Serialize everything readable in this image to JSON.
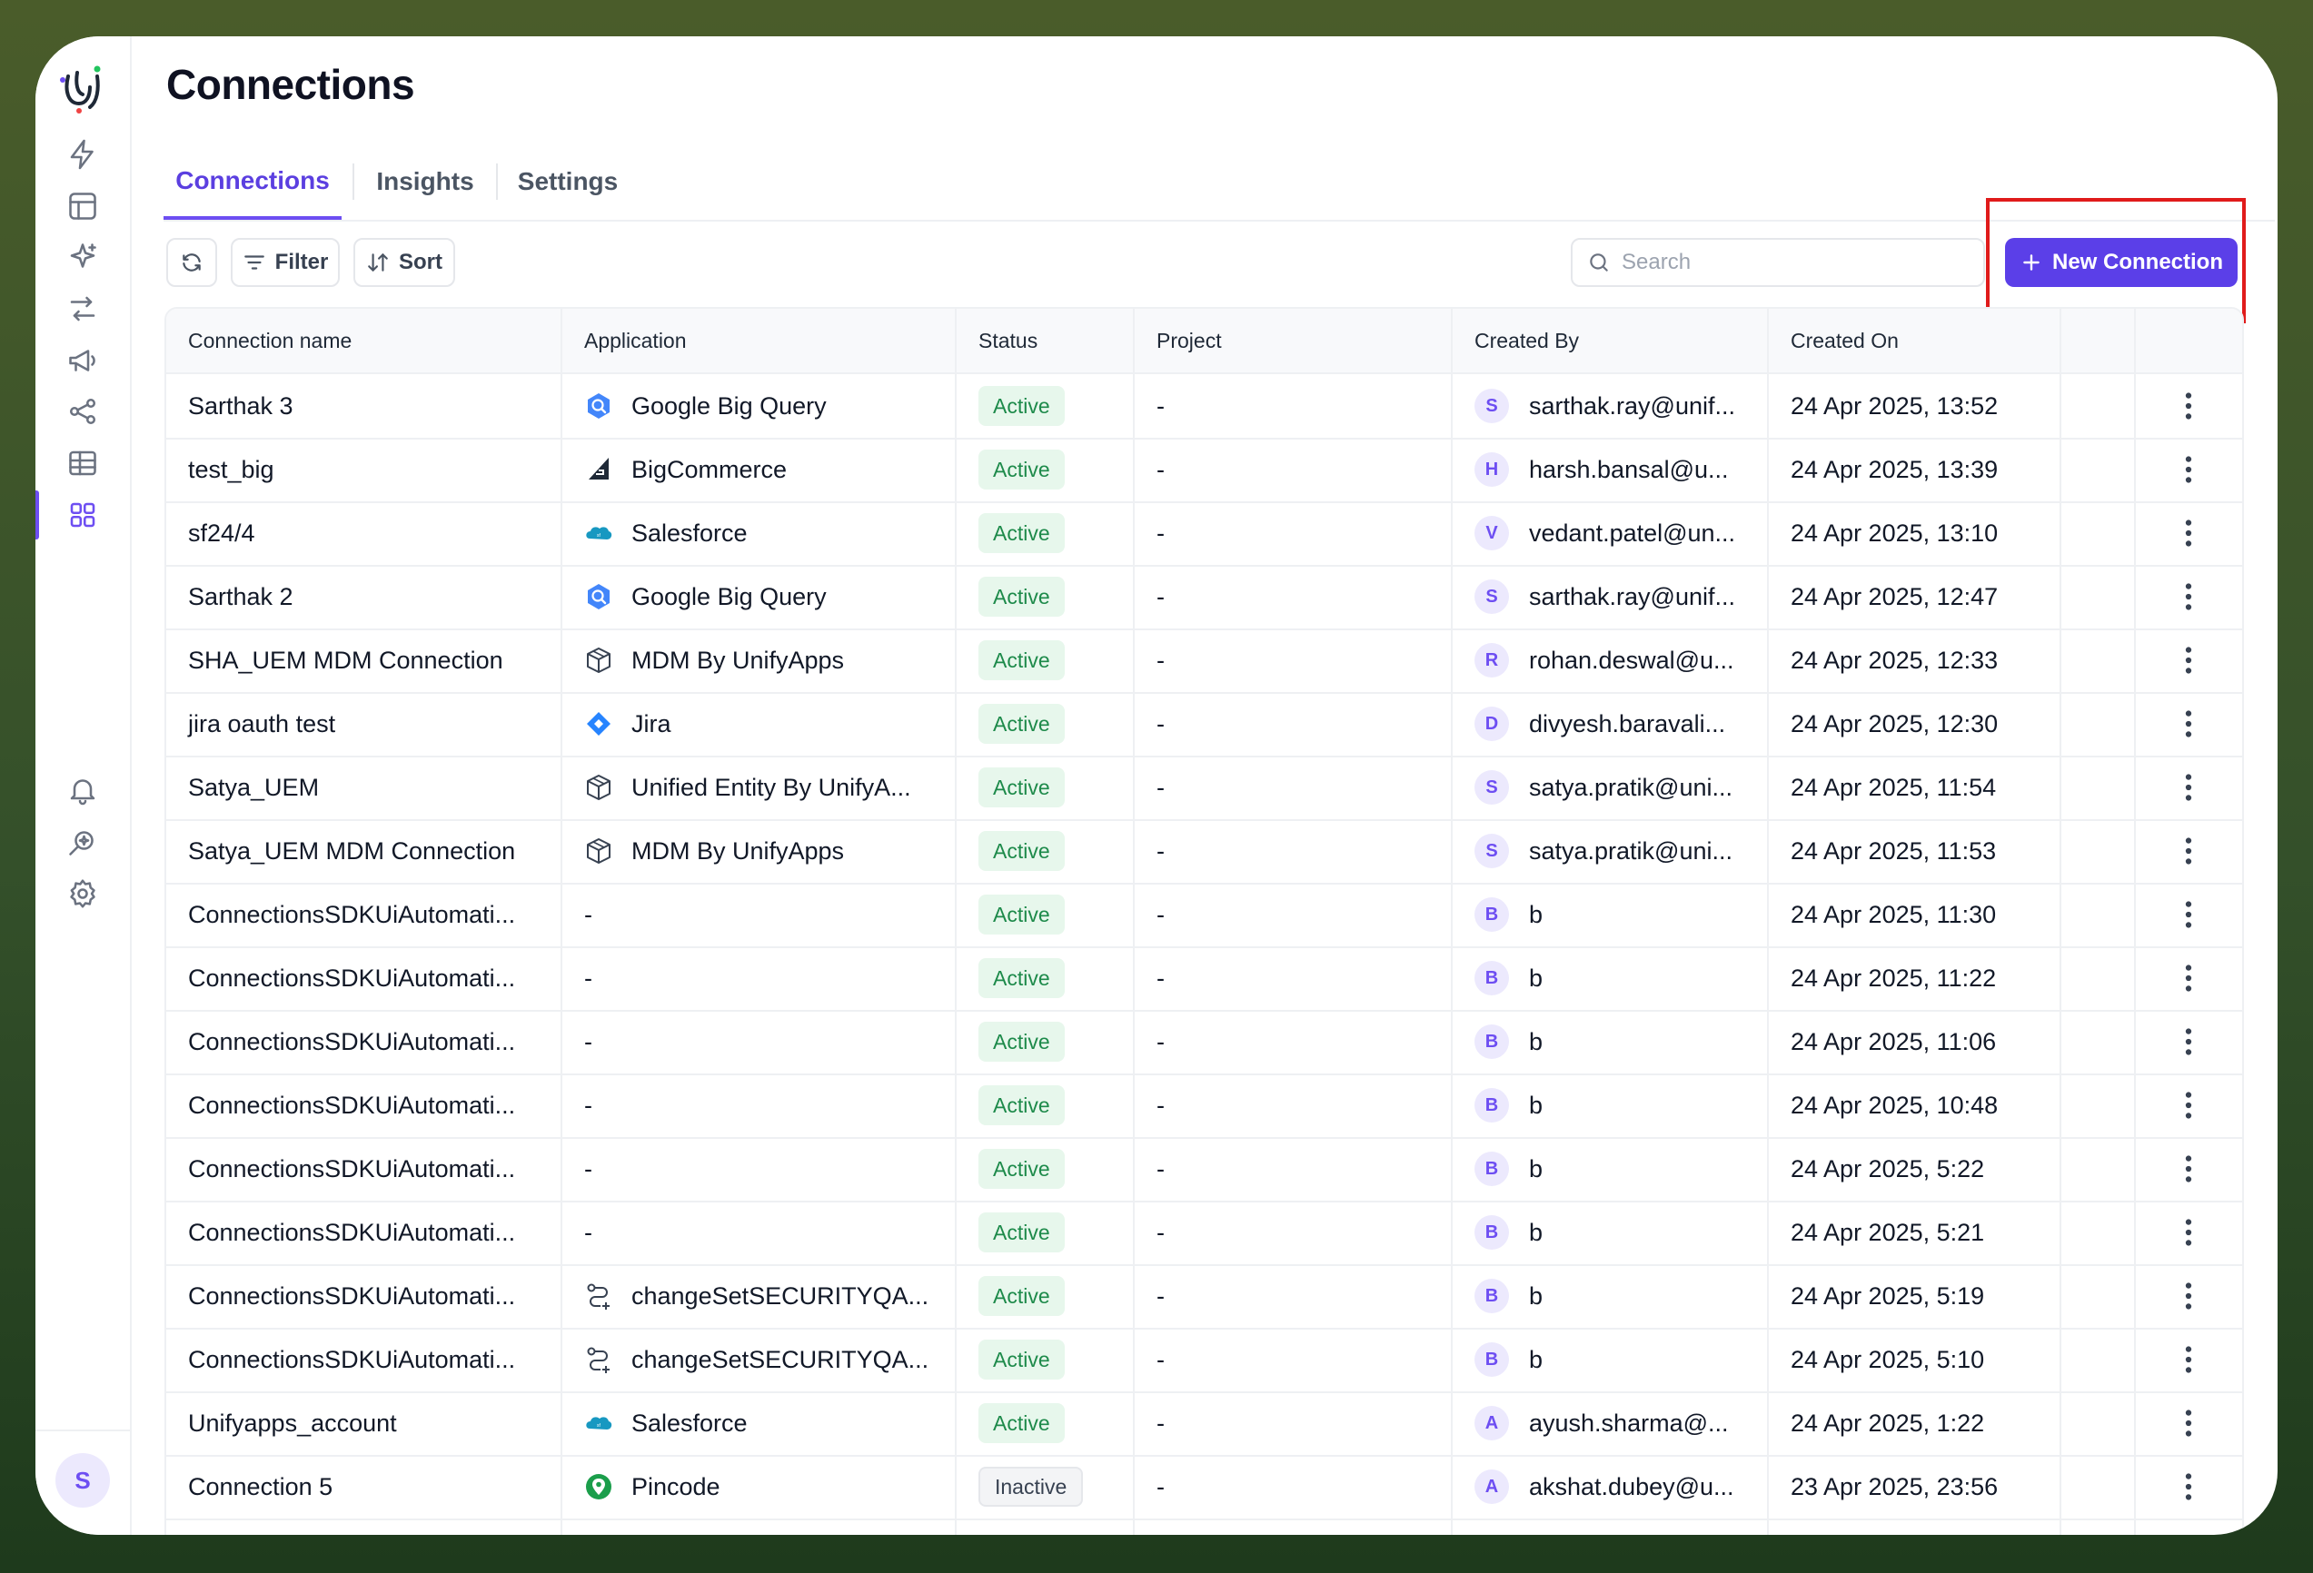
{
  "app": {
    "logo": "unifyapps-logo"
  },
  "sidebar": {
    "items": [
      {
        "icon": "lightning-icon"
      },
      {
        "icon": "layout-icon"
      },
      {
        "icon": "sparkle-icon"
      },
      {
        "icon": "flow-arrows-icon"
      },
      {
        "icon": "megaphone-icon"
      },
      {
        "icon": "share-nodes-icon"
      },
      {
        "icon": "table-icon"
      },
      {
        "icon": "grid-apps-icon",
        "active": true
      }
    ],
    "bottom": [
      {
        "icon": "bell-icon"
      },
      {
        "icon": "search-sparkle-icon"
      },
      {
        "icon": "settings-icon"
      }
    ],
    "user_initial": "S"
  },
  "page": {
    "title": "Connections"
  },
  "tabs": [
    {
      "label": "Connections",
      "active": true
    },
    {
      "label": "Insights"
    },
    {
      "label": "Settings"
    }
  ],
  "toolbar": {
    "filter_label": "Filter",
    "sort_label": "Sort",
    "search_placeholder": "Search",
    "new_button_label": "New Connection"
  },
  "table": {
    "columns": [
      "Connection name",
      "Application",
      "Status",
      "Project",
      "Created By",
      "Created On"
    ],
    "rows": [
      {
        "name": "Sarthak 3",
        "app": "Google Big Query",
        "app_icon": "bigquery",
        "status": "Active",
        "project": "-",
        "initial": "S",
        "created_by": "sarthak.ray@unif...",
        "created_on": "24 Apr 2025, 13:52"
      },
      {
        "name": "test_big",
        "app": "BigCommerce",
        "app_icon": "bigcommerce",
        "status": "Active",
        "project": "-",
        "initial": "H",
        "created_by": "harsh.bansal@u...",
        "created_on": "24 Apr 2025, 13:39"
      },
      {
        "name": "sf24/4",
        "app": "Salesforce",
        "app_icon": "salesforce",
        "status": "Active",
        "project": "-",
        "initial": "V",
        "created_by": "vedant.patel@un...",
        "created_on": "24 Apr 2025, 13:10"
      },
      {
        "name": "Sarthak 2",
        "app": "Google Big Query",
        "app_icon": "bigquery",
        "status": "Active",
        "project": "-",
        "initial": "S",
        "created_by": "sarthak.ray@unif...",
        "created_on": "24 Apr 2025, 12:47"
      },
      {
        "name": "SHA_UEM MDM Connection",
        "app": "MDM By UnifyApps",
        "app_icon": "cube",
        "status": "Active",
        "project": "-",
        "initial": "R",
        "created_by": "rohan.deswal@u...",
        "created_on": "24 Apr 2025, 12:33"
      },
      {
        "name": "jira oauth test",
        "app": "Jira",
        "app_icon": "jira",
        "status": "Active",
        "project": "-",
        "initial": "D",
        "created_by": "divyesh.baravali...",
        "created_on": "24 Apr 2025, 12:30"
      },
      {
        "name": "Satya_UEM",
        "app": "Unified Entity By UnifyA...",
        "app_icon": "cube",
        "status": "Active",
        "project": "-",
        "initial": "S",
        "created_by": "satya.pratik@uni...",
        "created_on": "24 Apr 2025, 11:54"
      },
      {
        "name": "Satya_UEM MDM Connection",
        "app": "MDM By UnifyApps",
        "app_icon": "cube",
        "status": "Active",
        "project": "-",
        "initial": "S",
        "created_by": "satya.pratik@uni...",
        "created_on": "24 Apr 2025, 11:53"
      },
      {
        "name": "ConnectionsSDKUiAutomati...",
        "app": "-",
        "app_icon": "",
        "status": "Active",
        "project": "-",
        "initial": "B",
        "created_by": "b",
        "created_on": "24 Apr 2025, 11:30"
      },
      {
        "name": "ConnectionsSDKUiAutomati...",
        "app": "-",
        "app_icon": "",
        "status": "Active",
        "project": "-",
        "initial": "B",
        "created_by": "b",
        "created_on": "24 Apr 2025, 11:22"
      },
      {
        "name": "ConnectionsSDKUiAutomati...",
        "app": "-",
        "app_icon": "",
        "status": "Active",
        "project": "-",
        "initial": "B",
        "created_by": "b",
        "created_on": "24 Apr 2025, 11:06"
      },
      {
        "name": "ConnectionsSDKUiAutomati...",
        "app": "-",
        "app_icon": "",
        "status": "Active",
        "project": "-",
        "initial": "B",
        "created_by": "b",
        "created_on": "24 Apr 2025, 10:48"
      },
      {
        "name": "ConnectionsSDKUiAutomati...",
        "app": "-",
        "app_icon": "",
        "status": "Active",
        "project": "-",
        "initial": "B",
        "created_by": "b",
        "created_on": "24 Apr 2025, 5:22"
      },
      {
        "name": "ConnectionsSDKUiAutomati...",
        "app": "-",
        "app_icon": "",
        "status": "Active",
        "project": "-",
        "initial": "B",
        "created_by": "b",
        "created_on": "24 Apr 2025, 5:21"
      },
      {
        "name": "ConnectionsSDKUiAutomati...",
        "app": "changeSetSECURITYQA...",
        "app_icon": "route",
        "status": "Active",
        "project": "-",
        "initial": "B",
        "created_by": "b",
        "created_on": "24 Apr 2025, 5:19"
      },
      {
        "name": "ConnectionsSDKUiAutomati...",
        "app": "changeSetSECURITYQA...",
        "app_icon": "route",
        "status": "Active",
        "project": "-",
        "initial": "B",
        "created_by": "b",
        "created_on": "24 Apr 2025, 5:10"
      },
      {
        "name": "Unifyapps_account",
        "app": "Salesforce",
        "app_icon": "salesforce",
        "status": "Active",
        "project": "-",
        "initial": "A",
        "created_by": "ayush.sharma@...",
        "created_on": "24 Apr 2025, 1:22"
      },
      {
        "name": "Connection 5",
        "app": "Pincode",
        "app_icon": "pincode",
        "status": "Inactive",
        "project": "-",
        "initial": "A",
        "created_by": "akshat.dubey@u...",
        "created_on": "23 Apr 2025, 23:56"
      }
    ]
  },
  "colors": {
    "accent": "#5b3fe8",
    "active_bg": "#e7f7ec",
    "active_text": "#1d8a4a",
    "highlight": "#e01b1b"
  }
}
